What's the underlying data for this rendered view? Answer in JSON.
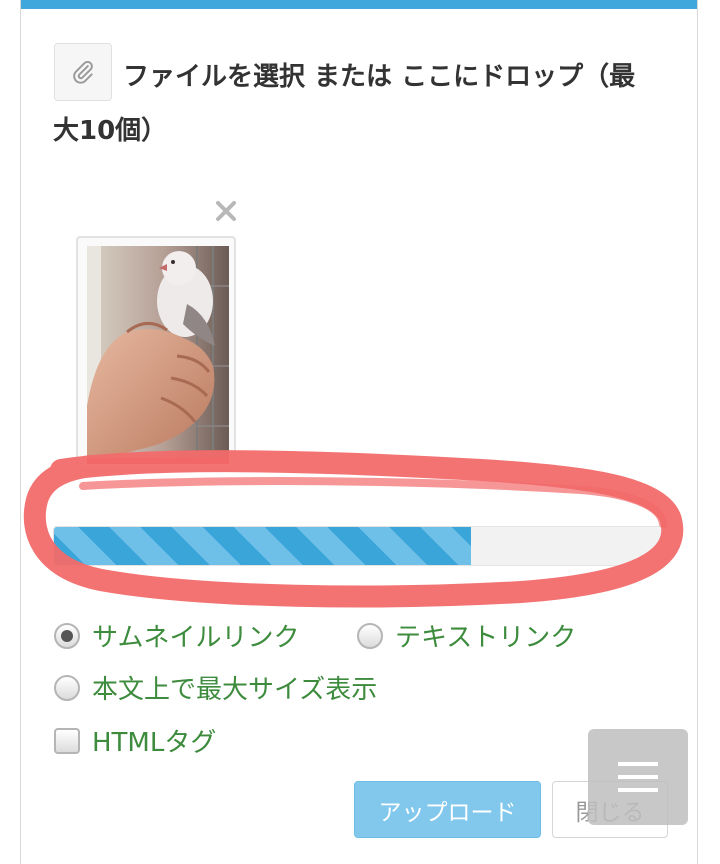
{
  "uploader": {
    "instruction_line1": "ファイルを選択 または ここにドロップ（最",
    "instruction_line2": "大10個）",
    "icons": {
      "attach": "paperclip-icon",
      "remove": "close-icon",
      "menu": "hamburger-menu-icon"
    },
    "progress_fraction": 0.68,
    "colors": {
      "accent": "#3fa7dc",
      "progress": "#3aa5d9",
      "highlight_annotation": "#f26a6a",
      "option_text": "#3d8b3d"
    }
  },
  "options": {
    "thumbnail_link": "サムネイルリンク",
    "text_link": "テキストリンク",
    "max_size_display": "本文上で最大サイズ表示",
    "html_tag": "HTMLタグ",
    "selected": "thumbnail_link",
    "html_tag_checked": false
  },
  "buttons": {
    "upload": "アップロード",
    "close": "閉じる"
  }
}
